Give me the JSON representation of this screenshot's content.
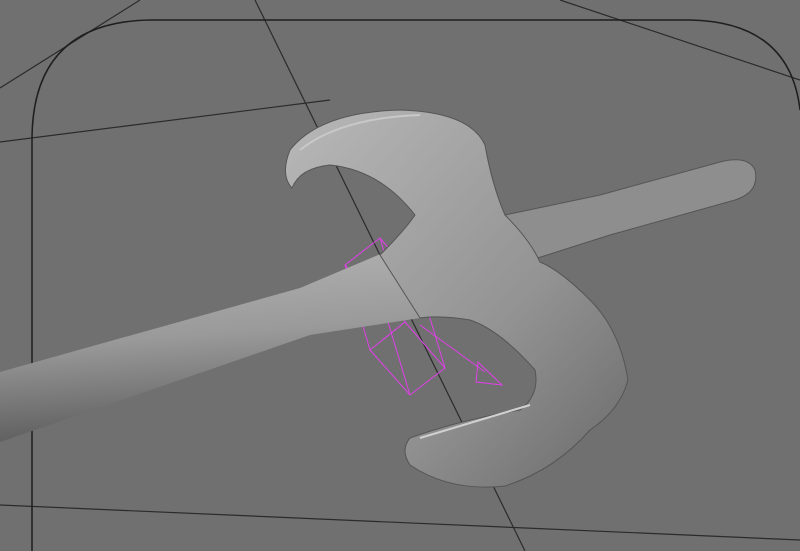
{
  "viewport": {
    "background_color": "#707070",
    "grid_color": "#2a2a2a",
    "frame_color": "#1e1e1e",
    "model_color": "#9a9a9a",
    "gizmo_color": "#e040e8"
  },
  "objects": [
    {
      "name": "axe-model",
      "selected": true
    },
    {
      "name": "transform-gizmo",
      "icon": "move-arrow-icon"
    }
  ]
}
